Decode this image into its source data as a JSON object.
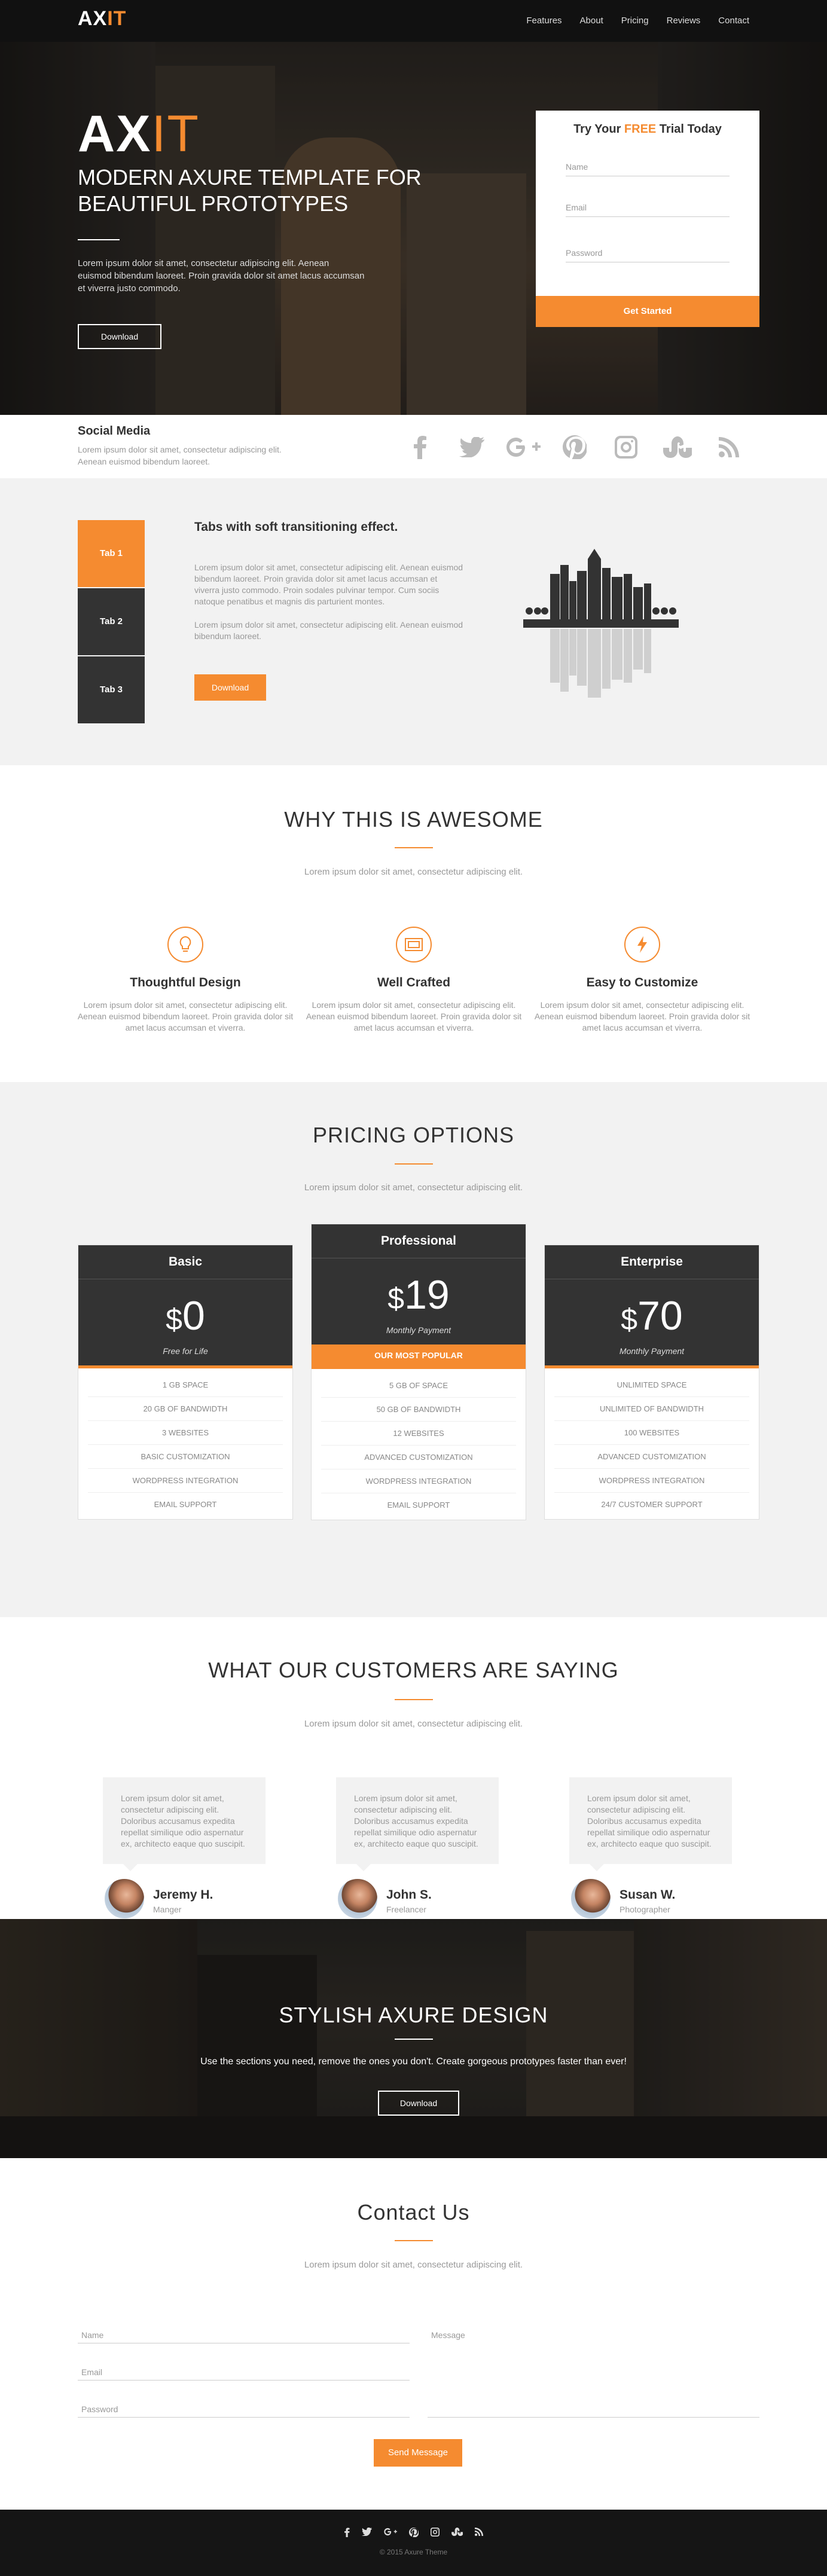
{
  "colors": {
    "accent": "#f58b30",
    "dark": "#333333",
    "nav_bg": "#111111",
    "light_bg": "#f2f2f2"
  },
  "nav": {
    "logo_main": "AX",
    "logo_accent": "IT",
    "items": [
      {
        "label": "Features"
      },
      {
        "label": "About"
      },
      {
        "label": "Pricing"
      },
      {
        "label": "Reviews"
      },
      {
        "label": "Contact"
      }
    ]
  },
  "hero": {
    "logo_main": "AX",
    "logo_accent": "IT",
    "title": "Modern Axure template for beautiful prototypes",
    "text": "Lorem ipsum dolor sit amet, consectetur adipiscing elit. Aenean euismod bibendum laoreet. Proin gravida dolor sit amet lacus accumsan et viverra justo commodo.",
    "button": "Download",
    "trial": {
      "title_pre": "Try Your ",
      "title_accent": "FREE",
      "title_post": " Trial Today",
      "name_placeholder": "Name",
      "email_placeholder": "Email",
      "password_placeholder": "Password",
      "button": "Get Started"
    }
  },
  "social": {
    "title": "Social Media",
    "text": "Lorem ipsum dolor sit amet, consectetur adipiscing elit. Aenean euismod bibendum laoreet.",
    "icons": [
      "facebook-icon",
      "twitter-icon",
      "google-plus-icon",
      "pinterest-icon",
      "instagram-icon",
      "stumbleupon-icon",
      "rss-icon"
    ]
  },
  "tabs": {
    "items": [
      {
        "label": "Tab 1",
        "active": true
      },
      {
        "label": "Tab 2",
        "active": false
      },
      {
        "label": "Tab 3",
        "active": false
      }
    ],
    "title": "Tabs with soft transitioning effect.",
    "p1": "Lorem ipsum dolor sit amet, consectetur adipiscing elit. Aenean euismod bibendum laoreet. Proin gravida dolor sit amet lacus accumsan et viverra justo commodo. Proin sodales pulvinar tempor. Cum sociis natoque penatibus et magnis dis parturient montes.",
    "p2": "Lorem ipsum dolor sit amet, consectetur adipiscing elit. Aenean euismod bibendum laoreet.",
    "button": "Download"
  },
  "features": {
    "title": "WHY THIS IS AWESOME",
    "subtitle": "Lorem ipsum dolor sit amet, consectetur adipiscing elit.",
    "items": [
      {
        "icon": "lightbulb-icon",
        "name": "Thoughtful Design",
        "text": "Lorem ipsum dolor sit amet, consectetur adipiscing elit. Aenean euismod bibendum laoreet. Proin gravida dolor sit amet lacus accumsan et viverra."
      },
      {
        "icon": "envelope-icon",
        "name": "Well Crafted",
        "text": "Lorem ipsum dolor sit amet, consectetur adipiscing elit. Aenean euismod bibendum laoreet. Proin gravida dolor sit amet lacus accumsan et viverra."
      },
      {
        "icon": "lightning-icon",
        "name": "Easy to Customize",
        "text": "Lorem ipsum dolor sit amet, consectetur adipiscing elit. Aenean euismod bibendum laoreet. Proin gravida dolor sit amet lacus accumsan et viverra."
      }
    ]
  },
  "pricing": {
    "title": "PRICING OPTIONS",
    "subtitle": "Lorem ipsum dolor sit amet, consectetur adipiscing elit.",
    "plans": [
      {
        "name": "Basic",
        "currency": "$",
        "price": "0",
        "period": "Free for Life",
        "popular": "",
        "features": [
          "1 GB Space",
          "20 GB of Bandwidth",
          "3 Websites",
          "Basic Customization",
          "WordPress Integration",
          "Email Support"
        ]
      },
      {
        "name": "Professional",
        "currency": "$",
        "price": "19",
        "period": "Monthly Payment",
        "popular": "OUR MOST POPULAR",
        "features": [
          "5 GB of Space",
          "50 GB of Bandwidth",
          "12 Websites",
          "Advanced Customization",
          "WordPress Integration",
          "Email Support"
        ]
      },
      {
        "name": "Enterprise",
        "currency": "$",
        "price": "70",
        "period": "Monthly Payment",
        "popular": "",
        "features": [
          "Unlimited Space",
          "Unlimited of Bandwidth",
          "100 Websites",
          "Advanced Customization",
          "WordPress Integration",
          "24/7 Customer Support"
        ]
      }
    ]
  },
  "testimonials": {
    "title": "WHAT OUR CUSTOMERS ARE SAYING",
    "subtitle": "Lorem ipsum dolor sit amet, consectetur adipiscing elit.",
    "items": [
      {
        "quote": "Lorem ipsum dolor sit amet, consectetur adipiscing elit. Doloribus accusamus expedita repellat similique odio aspernatur ex, architecto eaque quo suscipit.",
        "name": "Jeremy H.",
        "role": "Manger"
      },
      {
        "quote": "Lorem ipsum dolor sit amet, consectetur adipiscing elit. Doloribus accusamus expedita repellat similique odio aspernatur ex, architecto eaque quo suscipit.",
        "name": "John S.",
        "role": "Freelancer"
      },
      {
        "quote": "Lorem ipsum dolor sit amet, consectetur adipiscing elit. Doloribus accusamus expedita repellat similique odio aspernatur ex, architecto eaque quo suscipit.",
        "name": "Susan W.",
        "role": "Photographer"
      }
    ]
  },
  "cta": {
    "title": "STYLISH AXURE DESIGN",
    "text": "Use the sections you need, remove the ones you don't. Create gorgeous prototypes faster than ever!",
    "button": "Download"
  },
  "contact": {
    "title": "Contact Us",
    "subtitle": "Lorem ipsum dolor sit amet, consectetur adipiscing elit.",
    "name_placeholder": "Name",
    "email_placeholder": "Email",
    "password_placeholder": "Password",
    "message_placeholder": "Message",
    "button": "Send Message"
  },
  "footer": {
    "icons": [
      "facebook-icon",
      "twitter-icon",
      "google-plus-icon",
      "pinterest-icon",
      "instagram-icon",
      "stumbleupon-icon",
      "rss-icon"
    ],
    "copyright": "© 2015 Axure Theme"
  }
}
